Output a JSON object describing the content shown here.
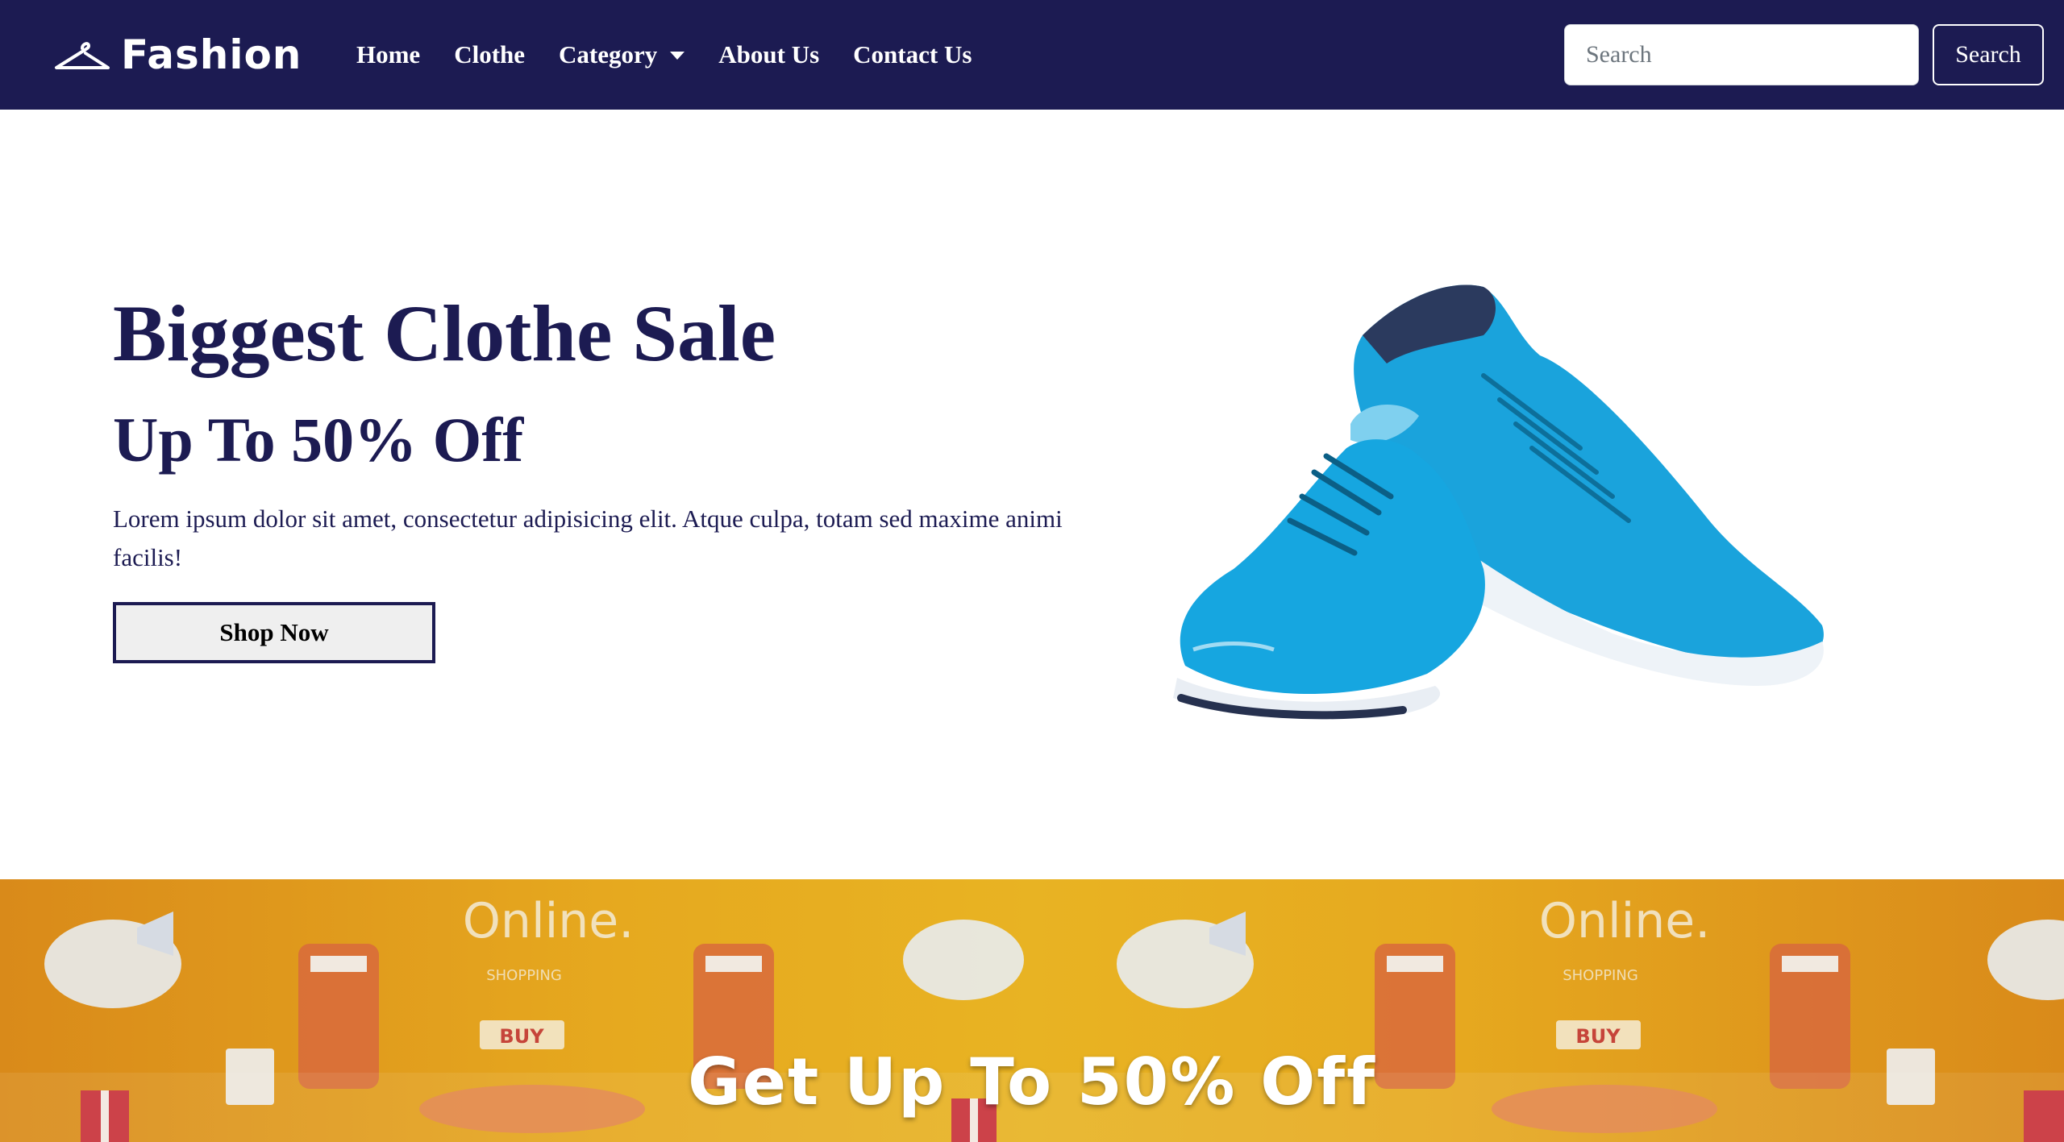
{
  "navbar": {
    "brand": "Fashion",
    "links": [
      {
        "label": "Home"
      },
      {
        "label": "Clothe"
      },
      {
        "label": "Category"
      },
      {
        "label": "About Us"
      },
      {
        "label": "Contact Us"
      }
    ],
    "search_placeholder": "Search",
    "search_button": "Search",
    "colors": {
      "background": "#1c1b52",
      "text": "#ffffff"
    }
  },
  "hero": {
    "title": "Biggest Clothe Sale",
    "subtitle": "Up To 50% Off",
    "description": "Lorem ipsum dolor sit amet, consectetur adipisicing elit. Atque culpa, totam sed maxime animi facilis!",
    "cta_label": "Shop Now",
    "image": "blue-running-sneakers",
    "colors": {
      "heading": "#1c1b52",
      "shoe": "#1aa3dc"
    }
  },
  "banner": {
    "headline": "Get Up To 50% Off",
    "art_text": {
      "online": "Online.",
      "shopping": "SHOPPING",
      "buy": "BUY"
    },
    "colors": {
      "background": "#e6a91f"
    }
  }
}
